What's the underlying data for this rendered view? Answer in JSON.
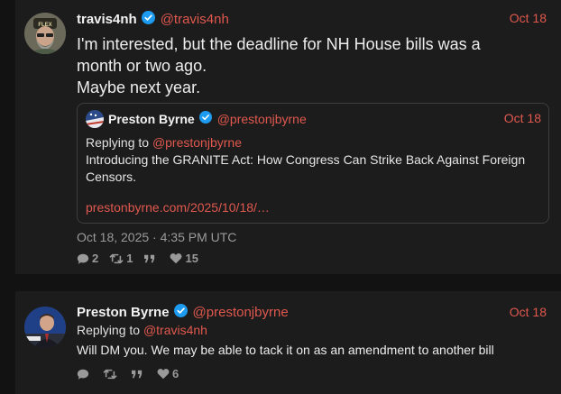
{
  "post1": {
    "display_name": "travis4nh",
    "handle": "@travis4nh",
    "date": "Oct 18",
    "text_lines": [
      "I'm interested, but the deadline for NH House bills was a",
      "month or two ago.",
      "Maybe next year."
    ],
    "quote": {
      "display_name": "Preston Byrne",
      "handle": "@prestonjbyrne",
      "date": "Oct 18",
      "replying_prefix": "Replying to ",
      "replying_handle": "@prestonjbyrne",
      "text_lines": [
        "Introducing the GRANITE Act: How Congress Can Strike Back Against Foreign",
        "Censors."
      ],
      "link": "prestonbyrne.com/2025/10/18/…"
    },
    "timestamp": "Oct 18, 2025 · 4:35 PM UTC",
    "stats": {
      "replies": "2",
      "reposts": "1",
      "quotes": "",
      "likes": "15"
    }
  },
  "post2": {
    "display_name": "Preston Byrne",
    "handle": "@prestonjbyrne",
    "date": "Oct 18",
    "replying_prefix": "Replying to ",
    "replying_handle": "@travis4nh",
    "text": "Will DM you. We may be able to tack it on as an amendment to another bill",
    "stats": {
      "replies": "",
      "reposts": "",
      "quotes": "",
      "likes": "6"
    }
  },
  "colors": {
    "accent": "#e0584e",
    "verified": "#1d9bf0",
    "muted": "#9a9a9a",
    "background": "#121212",
    "card": "#1c1c1c"
  },
  "icons": [
    "verified-badge-icon",
    "reply-icon",
    "repost-icon",
    "quote-icon",
    "like-icon"
  ]
}
